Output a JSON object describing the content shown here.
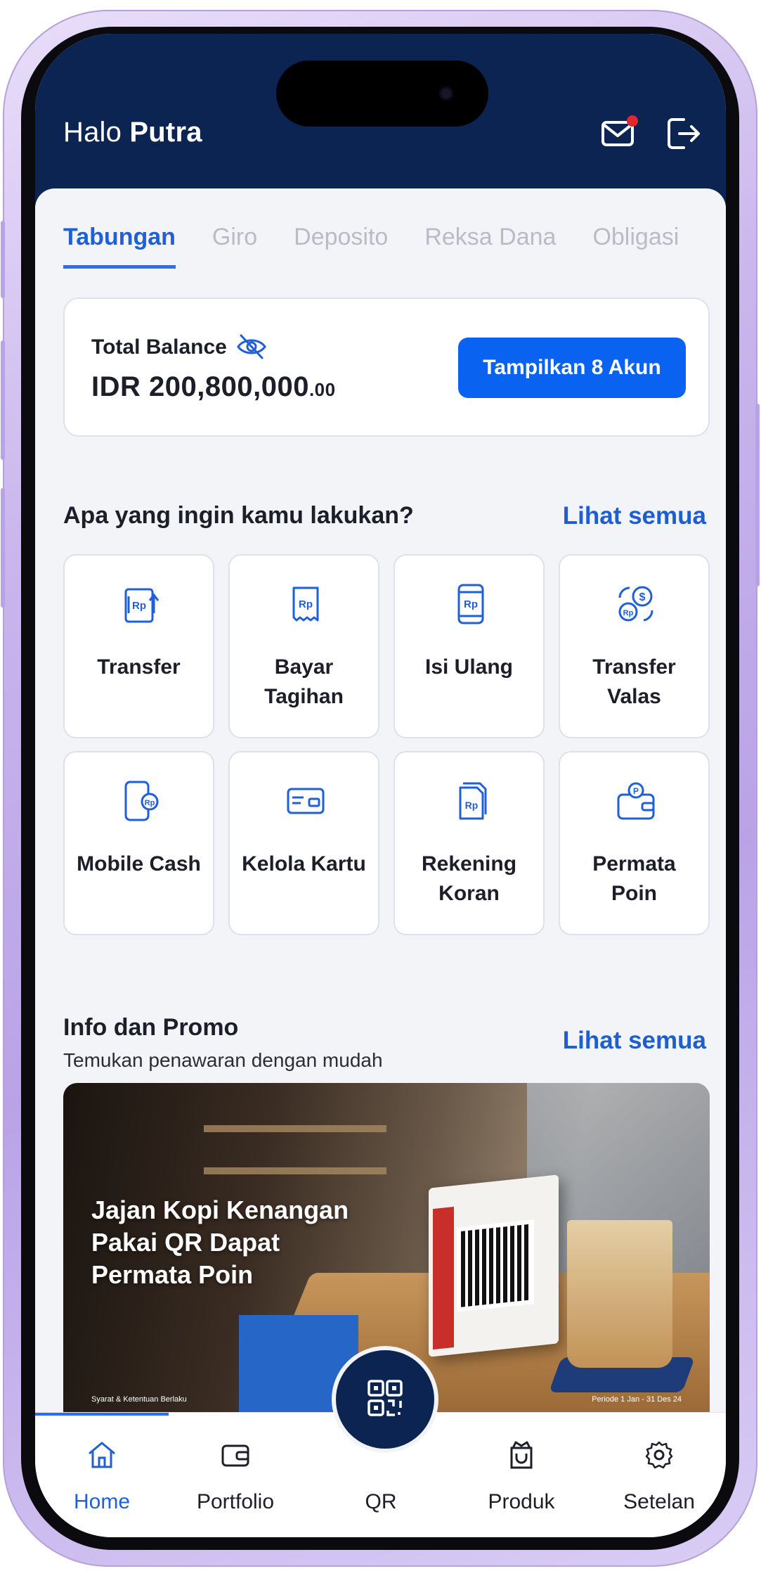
{
  "header": {
    "greeting_prefix": "Halo",
    "user_name": "Putra",
    "notification_dot_color": "#e2262a"
  },
  "tabs": [
    {
      "label": "Tabungan",
      "active": true
    },
    {
      "label": "Giro",
      "active": false
    },
    {
      "label": "Deposito",
      "active": false
    },
    {
      "label": "Reksa Dana",
      "active": false
    },
    {
      "label": "Obligasi",
      "active": false
    }
  ],
  "balance": {
    "label": "Total Balance",
    "currency_amount": "IDR 200,800,000",
    "decimals": ".00",
    "button_label": "Tampilkan 8 Akun"
  },
  "actions": {
    "title": "Apa yang ingin kamu lakukan?",
    "see_all": "Lihat semua",
    "items": [
      {
        "label": "Transfer",
        "icon": "transfer-icon"
      },
      {
        "label": "Bayar Tagihan",
        "icon": "bill-icon"
      },
      {
        "label": "Isi Ulang",
        "icon": "topup-phone-icon"
      },
      {
        "label": "Transfer Valas",
        "icon": "currency-exchange-icon"
      },
      {
        "label": "Mobile Cash",
        "icon": "mobile-cash-icon"
      },
      {
        "label": "Kelola Kartu",
        "icon": "card-icon"
      },
      {
        "label": "Rekening Koran",
        "icon": "statement-icon"
      },
      {
        "label": "Permata Poin",
        "icon": "wallet-points-icon"
      }
    ]
  },
  "promo": {
    "title": "Info dan Promo",
    "subtitle": "Temukan penawaran dengan mudah",
    "see_all": "Lihat semua",
    "banner_text": "Jajan Kopi Kenangan Pakai QR Dapat Permata Poin",
    "terms": "Syarat & Ketentuan Berlaku",
    "period": "Periode 1 Jan - 31 Des 24"
  },
  "nav": {
    "items": [
      {
        "label": "Home",
        "icon": "home-icon",
        "active": true
      },
      {
        "label": "Portfolio",
        "icon": "wallet-icon",
        "active": false
      },
      {
        "label": "QR",
        "icon": "qr-icon",
        "active": false
      },
      {
        "label": "Produk",
        "icon": "product-icon",
        "active": false
      },
      {
        "label": "Setelan",
        "icon": "gear-icon",
        "active": false
      }
    ]
  },
  "colors": {
    "header_navy": "#0b2452",
    "accent_blue": "#0a63f0",
    "link_blue": "#1e5fd0",
    "frame_lilac": "#c9b6ec"
  }
}
